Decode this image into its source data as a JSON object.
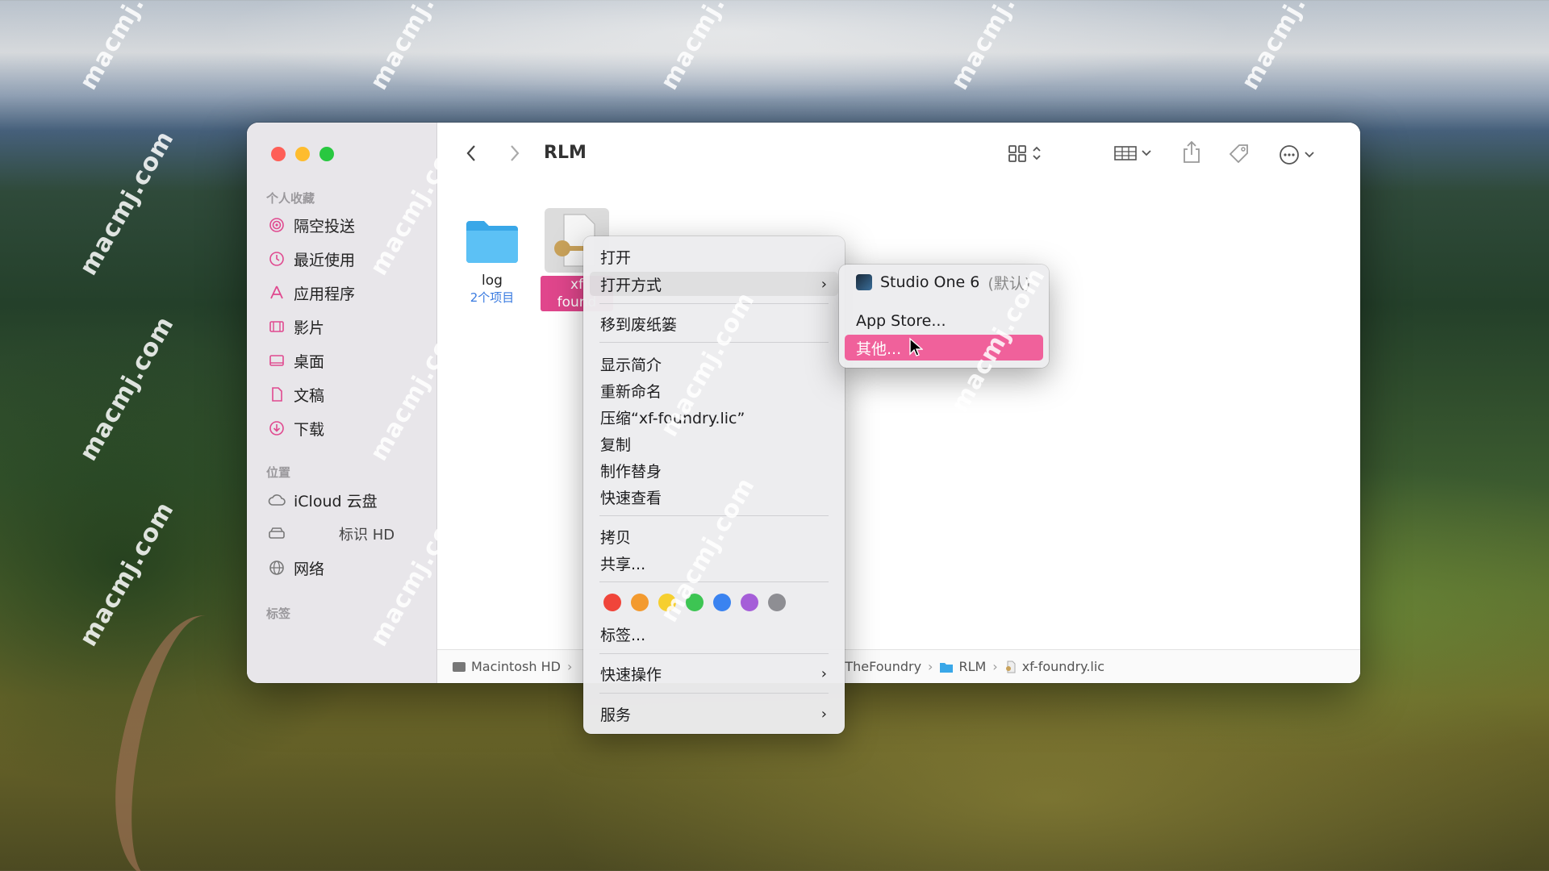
{
  "window": {
    "title": "RLM"
  },
  "sidebar": {
    "favorites_header": "个人收藏",
    "favorites": [
      {
        "label": "隔空投送",
        "icon": "airdrop-icon"
      },
      {
        "label": "最近使用",
        "icon": "clock-icon"
      },
      {
        "label": "应用程序",
        "icon": "applications-icon"
      },
      {
        "label": "影片",
        "icon": "film-icon"
      },
      {
        "label": "桌面",
        "icon": "desktop-icon"
      },
      {
        "label": "文稿",
        "icon": "document-icon"
      },
      {
        "label": "下载",
        "icon": "download-icon"
      }
    ],
    "locations_header": "位置",
    "locations": [
      {
        "label": "iCloud 云盘",
        "icon": "cloud-icon"
      },
      {
        "label": "标识 HD",
        "icon": "disk-icon"
      },
      {
        "label": "网络",
        "icon": "globe-icon"
      }
    ],
    "tags_header": "标签"
  },
  "files": [
    {
      "name": "log",
      "sub": "2个项目",
      "icon": "folder-icon"
    },
    {
      "name": "xf-\nfoundry.lic",
      "name_line1": "xf",
      "name_line2": "found",
      "icon": "license-file-icon"
    }
  ],
  "pathbar": {
    "items": [
      "Macintosh HD",
      "TheFoundry",
      "RLM",
      "xf-foundry.lic"
    ]
  },
  "context_menu": {
    "open": "打开",
    "open_with": "打开方式",
    "move_to_trash": "移到废纸篓",
    "get_info": "显示简介",
    "rename": "重新命名",
    "compress": "压缩“xf-foundry.lic”",
    "duplicate": "复制",
    "make_alias": "制作替身",
    "quick_look": "快速查看",
    "copy": "拷贝",
    "share": "共享...",
    "tag_colors": [
      "#f0453a",
      "#f39a2f",
      "#f6cf2f",
      "#3dc553",
      "#3a83f0",
      "#a55ed8",
      "#8e8e93"
    ],
    "tags": "标签...",
    "quick_actions": "快速操作",
    "services": "服务"
  },
  "submenu": {
    "default_app": "Studio One 6",
    "default_suffix": "(默认)",
    "app_store": "App Store...",
    "other": "其他..."
  },
  "colors": {
    "highlight": "#f0619b",
    "link_blue": "#3a7be0"
  },
  "watermark": "macmj.com"
}
